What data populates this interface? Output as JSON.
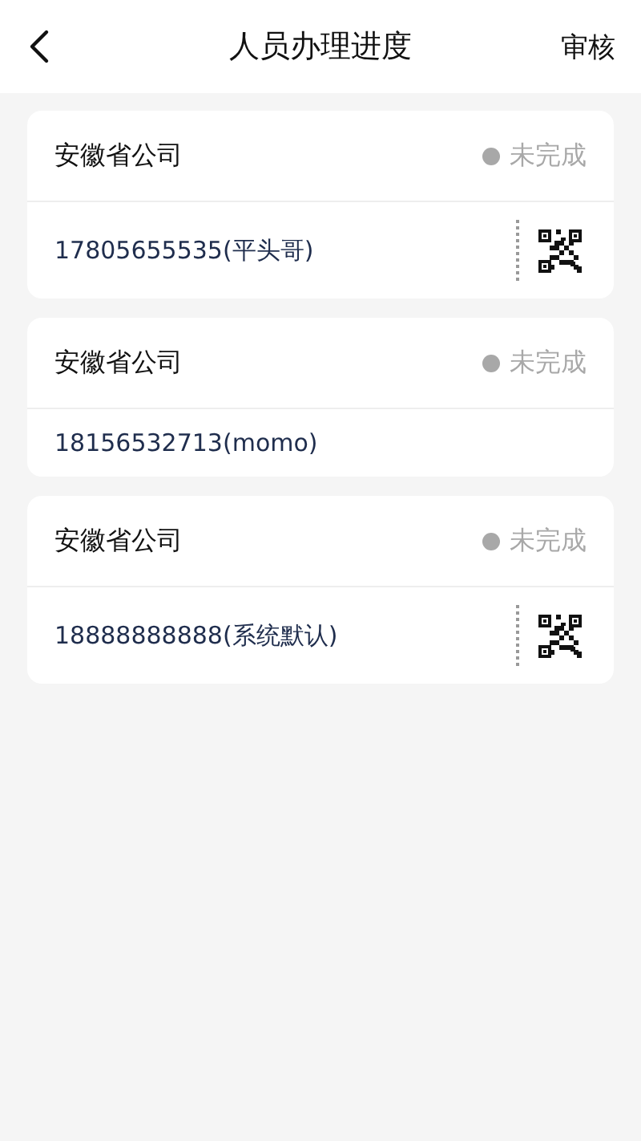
{
  "header": {
    "title": "人员办理进度",
    "action": "审核"
  },
  "cards": [
    {
      "company": "安徽省公司",
      "status": "未完成",
      "contact": "17805655535(平头哥)",
      "qr_code": true
    },
    {
      "company": "安徽省公司",
      "status": "未完成",
      "contact": "18156532713(momo)",
      "qr_code": false
    },
    {
      "company": "安徽省公司",
      "status": "未完成",
      "contact": "18888888888(系统默认)",
      "qr_code": true
    }
  ]
}
